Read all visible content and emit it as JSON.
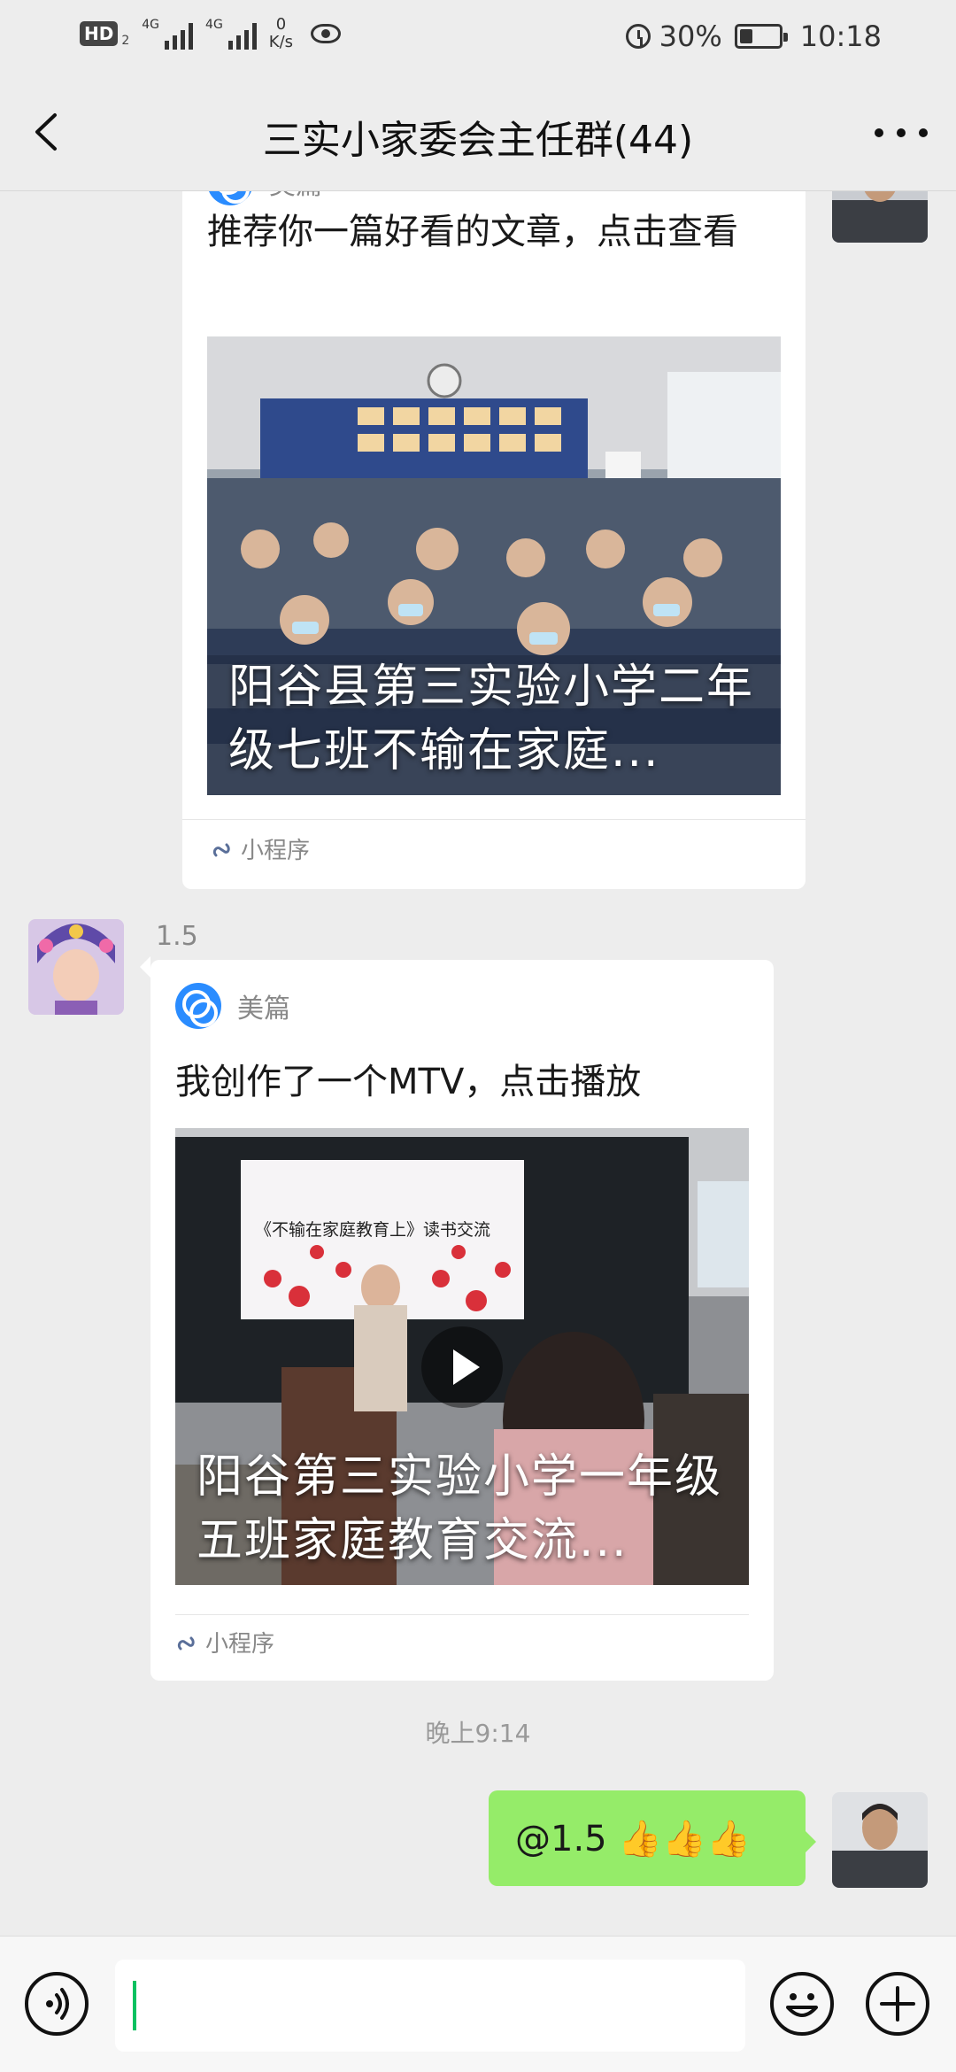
{
  "status_bar": {
    "hd_label": "HD",
    "hd_sub": "2",
    "network_1": "4G",
    "network_2": "4G",
    "speed_value": "0",
    "speed_unit": "K/s",
    "battery_percent": "30%",
    "time": "10:18",
    "icons": [
      "eye-icon",
      "alarm-icon",
      "battery-icon"
    ]
  },
  "nav": {
    "title": "三实小家委会主任群(44)",
    "back_icon": "chevron-left-icon",
    "more_icon": "more-icon"
  },
  "messages": [
    {
      "sender": "self",
      "type": "mini-program-card",
      "source": "美篇",
      "title": "推荐你一篇好看的文章，点击查看",
      "thumbnail_caption": "阳谷县第三实验小学二年级七班不输在家庭...",
      "footer_label": "小程序"
    },
    {
      "sender_name": "1.5",
      "type": "mini-program-card",
      "source": "美篇",
      "title": "我创作了一个MTV，点击播放",
      "thumbnail_caption": "阳谷第三实验小学一年级五班家庭教育交流...",
      "thumbnail_inner_text": "《不输在家庭教育上》读书交流",
      "footer_label": "小程序"
    }
  ],
  "timestamp": "晚上9:14",
  "reply": {
    "text": "@1.5 👍👍👍",
    "bubble_color": "#95ec69"
  },
  "input_bar": {
    "voice_icon": "voice-icon",
    "emoji_icon": "emoji-icon",
    "plus_icon": "plus-icon",
    "caret_color": "#07c160"
  }
}
